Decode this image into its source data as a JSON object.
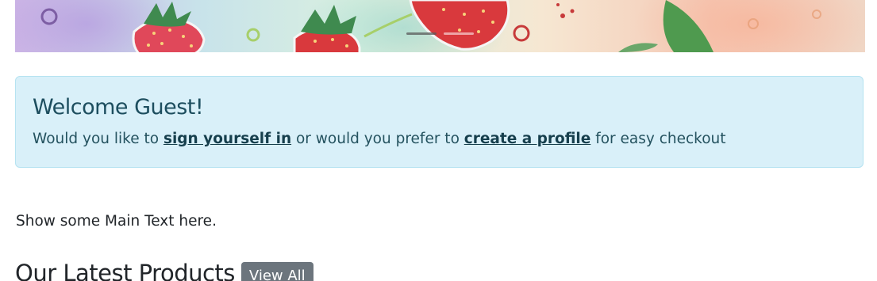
{
  "carousel": {
    "indicators": [
      "slide-1",
      "slide-2"
    ],
    "active_indicator": 1
  },
  "alert": {
    "title": "Welcome Guest!",
    "text_before": "Would you like to ",
    "signin_link": "sign yourself in",
    "text_middle": " or would you prefer to ",
    "profile_link": "create a profile",
    "text_after": " for easy checkout"
  },
  "main": {
    "text": "Show some Main Text here."
  },
  "products": {
    "title": "Our Latest Products",
    "view_all_label": "View All"
  },
  "colors": {
    "alert_bg": "#d9f0f9",
    "alert_border": "#b6e3f1",
    "alert_text": "#1d4e5f",
    "button_bg": "#6c757d",
    "strawberry": "#d9393d",
    "leaf": "#3f8a4f"
  }
}
